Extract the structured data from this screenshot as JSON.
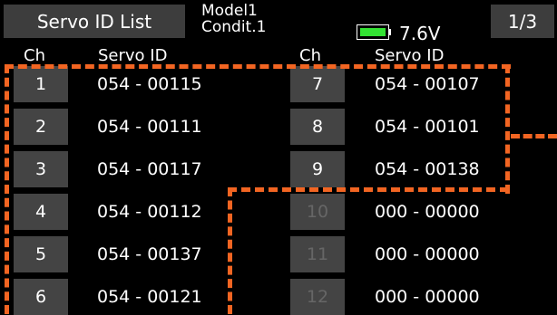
{
  "header": {
    "title": "Servo ID List",
    "model_line1": "Model1",
    "model_line2": "Condit.1",
    "battery_level": 1.0,
    "battery_color": "#33e233",
    "battery_icon": "battery-icon",
    "voltage": "7.6V",
    "page": "1/3"
  },
  "columns": {
    "ch_left": "Ch",
    "servo_left": "Servo ID",
    "ch_right": "Ch",
    "servo_right": "Servo ID"
  },
  "left_rows": [
    {
      "ch": "1",
      "id": "054 - 00115"
    },
    {
      "ch": "2",
      "id": "054 - 00111"
    },
    {
      "ch": "3",
      "id": "054 - 00117"
    },
    {
      "ch": "4",
      "id": "054 - 00112"
    },
    {
      "ch": "5",
      "id": "054 - 00137"
    },
    {
      "ch": "6",
      "id": "054 - 00121"
    }
  ],
  "right_rows": [
    {
      "ch": "7",
      "id": "054 - 00107"
    },
    {
      "ch": "8",
      "id": "054 - 00101"
    },
    {
      "ch": "9",
      "id": "054 - 00138"
    },
    {
      "ch": "10",
      "id": "000 - 00000"
    },
    {
      "ch": "11",
      "id": "000 - 00000"
    },
    {
      "ch": "12",
      "id": "000 - 00000"
    }
  ],
  "highlight_color": "#f26522"
}
